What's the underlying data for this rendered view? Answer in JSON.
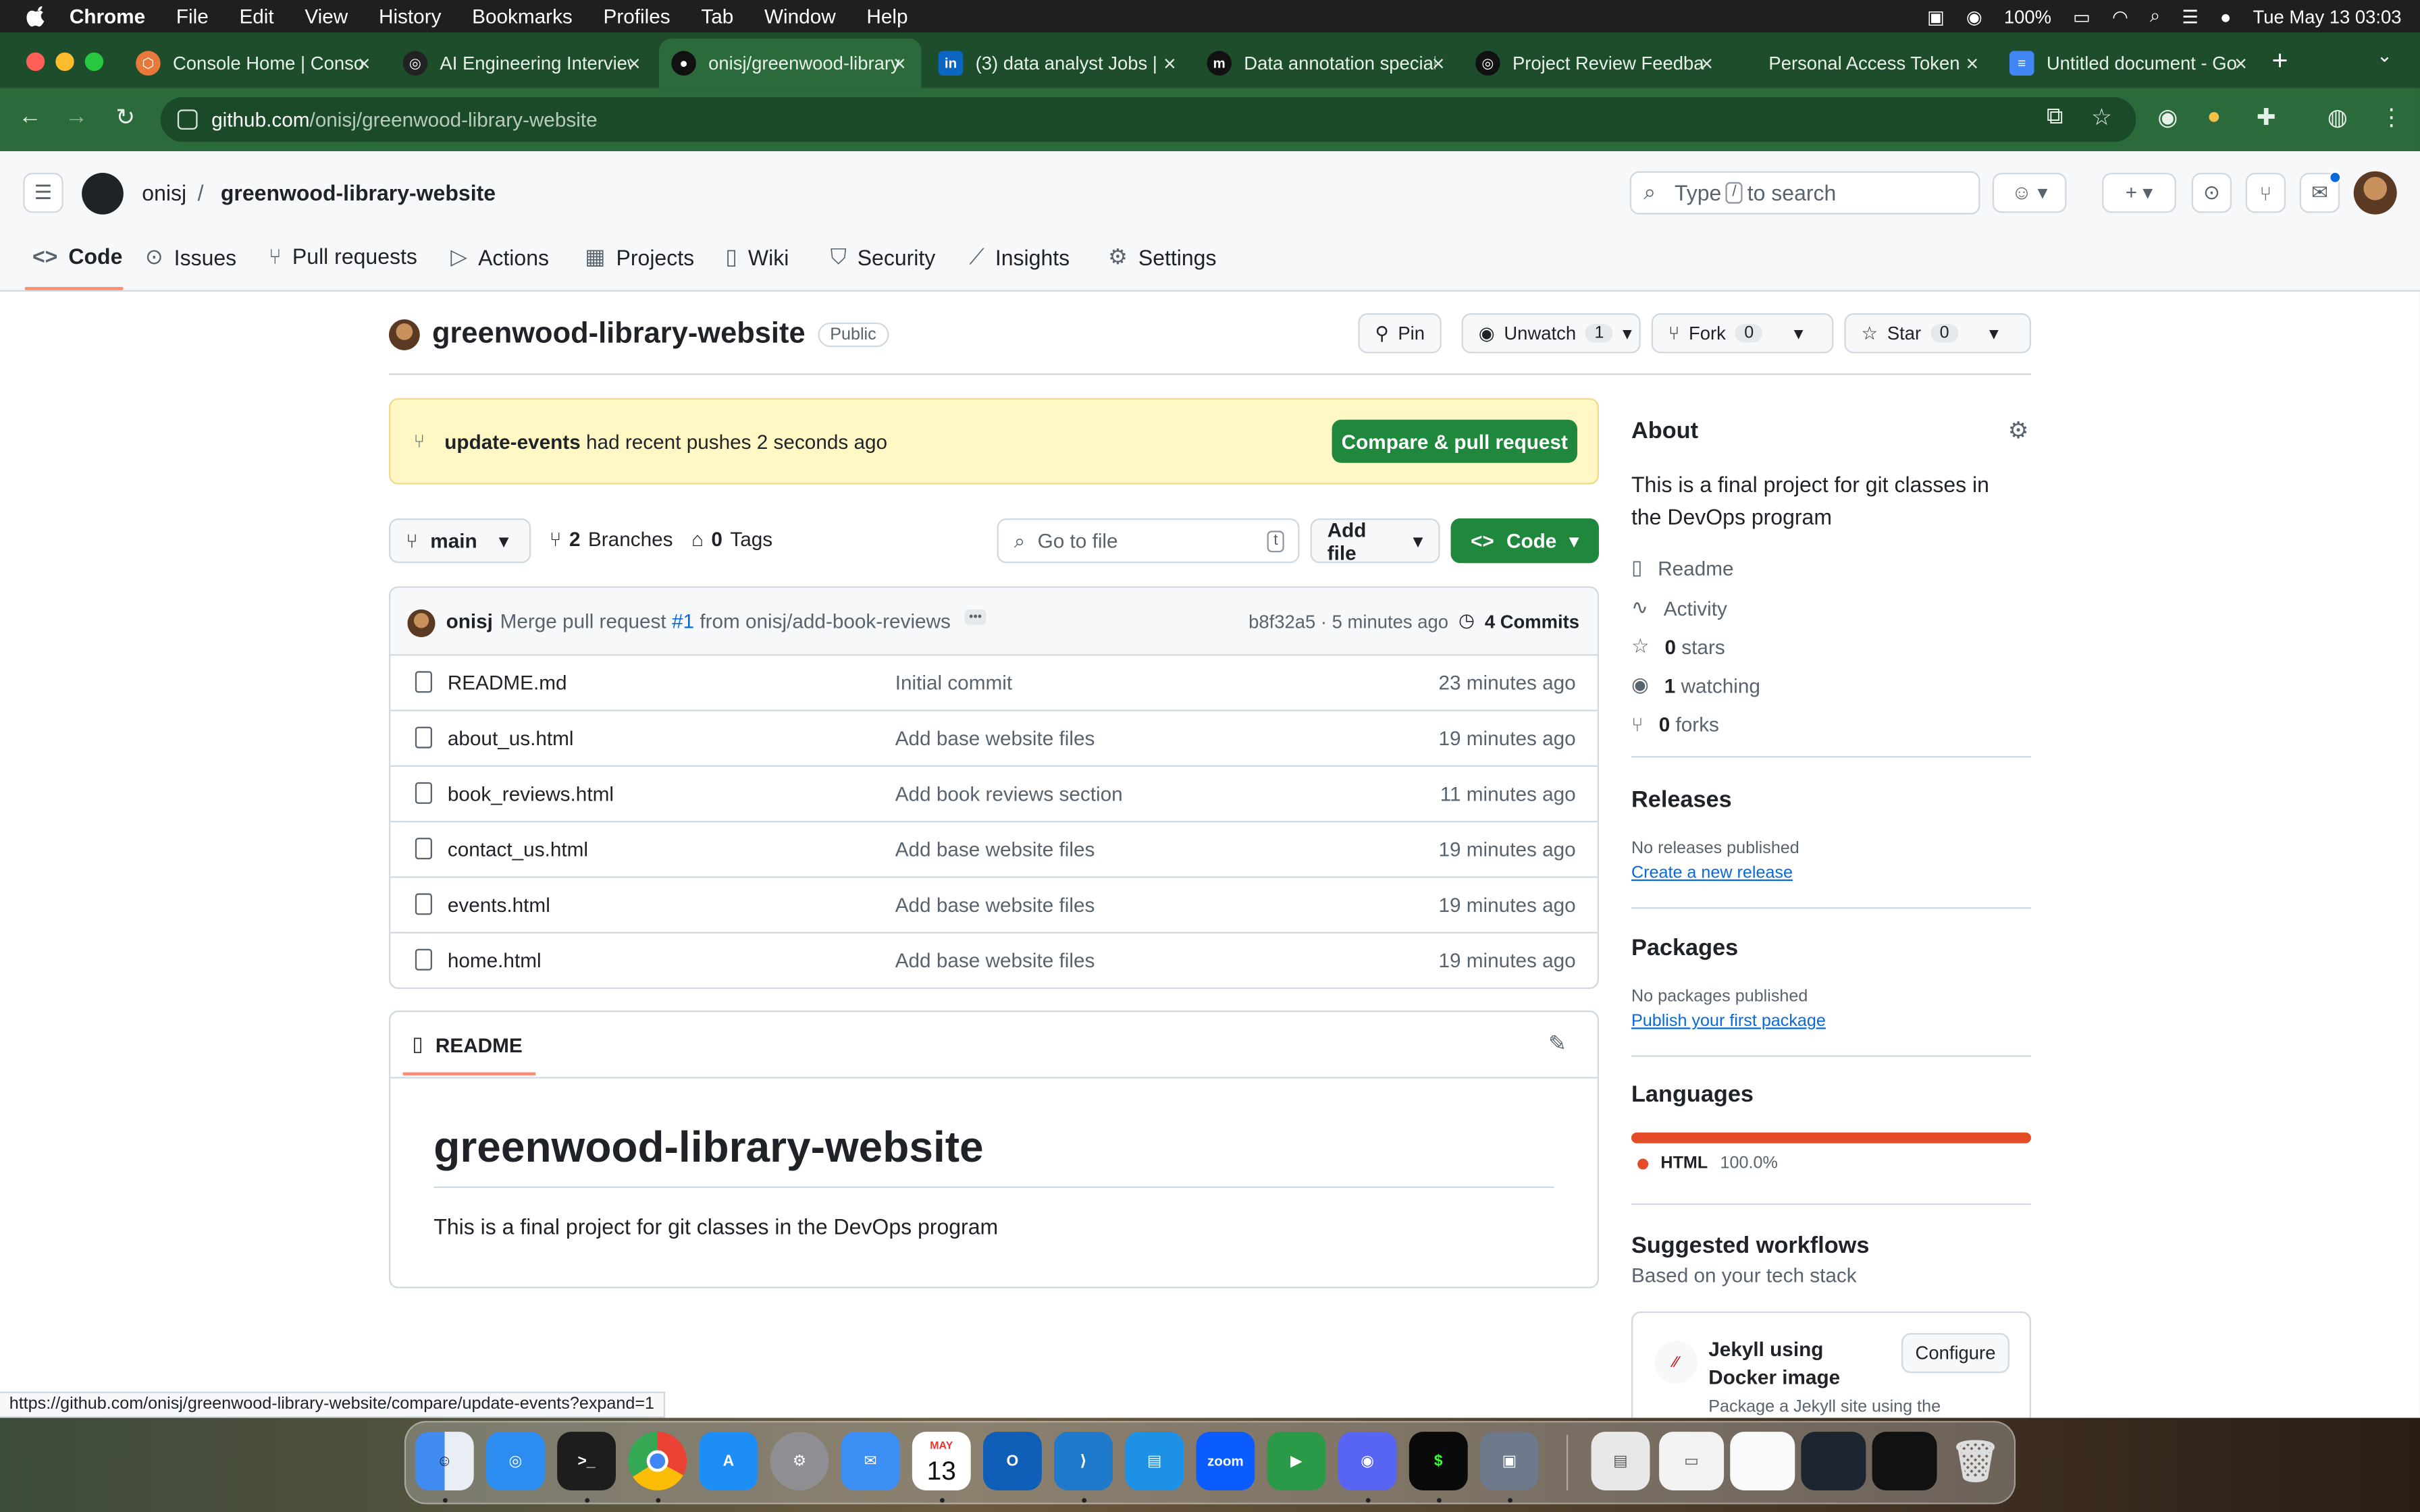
{
  "menubar": {
    "app": "Chrome",
    "items": [
      "File",
      "Edit",
      "View",
      "History",
      "Bookmarks",
      "Profiles",
      "Tab",
      "Window",
      "Help"
    ],
    "battery": "100%",
    "datetime": "Tue May 13  03:03"
  },
  "tabs": [
    {
      "title": "Console Home | Console",
      "color": "#e8793a",
      "glyph": "⬡"
    },
    {
      "title": "AI Engineering Interview",
      "color": "#222222",
      "glyph": "◎"
    },
    {
      "title": "onisj/greenwood-library",
      "color": "#111111",
      "glyph": "●"
    },
    {
      "title": "(3) data analyst Jobs | ",
      "color": "#0a66c2",
      "glyph": "in"
    },
    {
      "title": "Data annotation specialist",
      "color": "#111111",
      "glyph": "m"
    },
    {
      "title": "Project Review Feedback",
      "color": "#111111",
      "glyph": "◎"
    },
    {
      "title": "Personal Access Tokens",
      "color": "#1e4d2b",
      "glyph": "●"
    },
    {
      "title": "Untitled document - Google Docs",
      "color": "#4285f4",
      "glyph": "≡"
    }
  ],
  "address": {
    "host": "github.com",
    "path": "/onisj/greenwood-library-website"
  },
  "header": {
    "owner": "onisj",
    "repo": "greenwood-library-website",
    "search_prefix": "Type",
    "search_key": "/",
    "search_suffix": "to search"
  },
  "repo_nav": {
    "code": "Code",
    "issues": "Issues",
    "pulls": "Pull requests",
    "actions": "Actions",
    "projects": "Projects",
    "wiki": "Wiki",
    "security": "Security",
    "insights": "Insights",
    "settings": "Settings"
  },
  "repo_header": {
    "name": "greenwood-library-website",
    "visibility": "Public",
    "pin": "Pin",
    "unwatch": "Unwatch",
    "watch_count": "1",
    "fork": "Fork",
    "fork_count": "0",
    "star": "Star",
    "star_count": "0"
  },
  "banner": {
    "branch": "update-events",
    "text": "had recent pushes 2 seconds ago",
    "button": "Compare & pull request"
  },
  "controls": {
    "branch": "main",
    "branches_count": "2",
    "branches_label": "Branches",
    "tags_count": "0",
    "tags_label": "Tags",
    "goto_placeholder": "Go to file",
    "goto_key": "t",
    "add_file": "Add file",
    "code": "Code"
  },
  "latest_commit": {
    "author": "onisj",
    "msg_prefix": "Merge pull request",
    "pr": "#1",
    "msg_suffix": "from onisj/add-book-reviews",
    "sha_time": "b8f32a5 · 5 minutes ago",
    "commits": "4 Commits"
  },
  "files": [
    {
      "name": "README.md",
      "message": "Initial commit",
      "time": "23 minutes ago"
    },
    {
      "name": "about_us.html",
      "message": "Add base website files",
      "time": "19 minutes ago"
    },
    {
      "name": "book_reviews.html",
      "message": "Add book reviews section",
      "time": "11 minutes ago"
    },
    {
      "name": "contact_us.html",
      "message": "Add base website files",
      "time": "19 minutes ago"
    },
    {
      "name": "events.html",
      "message": "Add base website files",
      "time": "19 minutes ago"
    },
    {
      "name": "home.html",
      "message": "Add base website files",
      "time": "19 minutes ago"
    }
  ],
  "readme": {
    "tab": "README",
    "heading": "greenwood-library-website",
    "body": "This is a final project for git classes in the DevOps program"
  },
  "sidebar": {
    "about_title": "About",
    "about_text": "This is a final project for git classes in the DevOps program",
    "readme": "Readme",
    "activity": "Activity",
    "stars_count": "0",
    "stars_label": "stars",
    "watching_count": "1",
    "watching_label": "watching",
    "forks_count": "0",
    "forks_label": "forks",
    "releases_title": "Releases",
    "releases_none": "No releases published",
    "releases_link": "Create a new release",
    "packages_title": "Packages",
    "packages_none": "No packages published",
    "packages_link": "Publish your first package",
    "languages_title": "Languages",
    "lang_name": "HTML",
    "lang_pct": "100.0%",
    "lang_color": "#e34c26",
    "workflows_title": "Suggested workflows",
    "workflows_sub": "Based on your tech stack",
    "wf_name": "Jekyll using Docker image",
    "wf_desc": "Package a Jekyll site using the",
    "wf_button": "Configure"
  },
  "status_url": "https://github.com/onisj/greenwood-library-website/compare/update-events?expand=1",
  "dock": {
    "calendar_month": "MAY",
    "calendar_day": "13",
    "zoom": "zoom"
  }
}
